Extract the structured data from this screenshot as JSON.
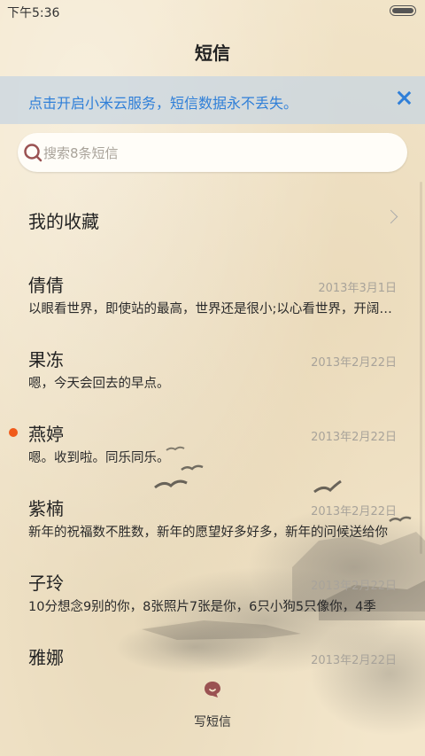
{
  "status_bar": {
    "time": "下午5:36"
  },
  "header": {
    "title": "短信"
  },
  "banner": {
    "text": "点击开启小米云服务，短信数据永不丢失。"
  },
  "search": {
    "placeholder": "搜索8条短信"
  },
  "favorites": {
    "label": "我的收藏"
  },
  "messages": [
    {
      "name": "倩倩",
      "date": "2013年3月1日",
      "preview": "以眼看世界，即使站的最高，世界还是很小;以心看世界，开阔心胸",
      "unread": false
    },
    {
      "name": "果冻",
      "date": "2013年2月22日",
      "preview": "嗯，今天会回去的早点。",
      "unread": false
    },
    {
      "name": "燕婷",
      "date": "2013年2月22日",
      "preview": "嗯。收到啦。同乐同乐。",
      "unread": true
    },
    {
      "name": "紫楠",
      "date": "2013年2月22日",
      "preview": "新年的祝福数不胜数，新年的愿望好多好多，新年的问候送给你",
      "unread": false
    },
    {
      "name": "子玲",
      "date": "2013年2月22日",
      "preview": "10分想念9别的你，8张照片7张是你，6只小狗5只像你，4季",
      "unread": false
    },
    {
      "name": "雅娜",
      "date": "2013年2月22日",
      "preview": "",
      "unread": false
    }
  ],
  "compose": {
    "label": "写短信"
  },
  "colors": {
    "accent_blue": "#2f7fd8",
    "unread_dot": "#f05a1a",
    "icon_maroon": "#9a5252"
  }
}
